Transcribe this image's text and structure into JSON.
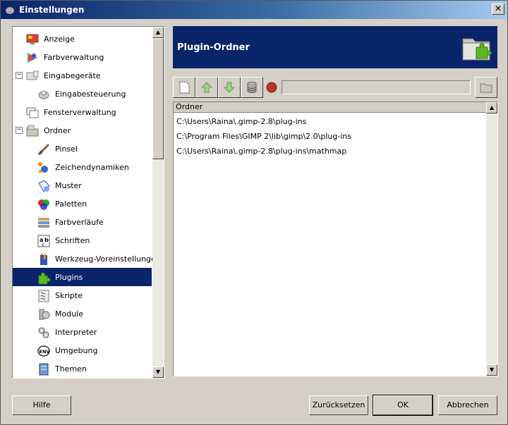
{
  "window": {
    "title": "Einstellungen"
  },
  "sidebar": {
    "items": [
      {
        "label": "Anzeige",
        "icon": "monitor-icon",
        "level": 0
      },
      {
        "label": "Farbverwaltung",
        "icon": "color-management-icon",
        "level": 0
      },
      {
        "label": "Eingabegeräte",
        "icon": "input-devices-icon",
        "level": 0,
        "expander": "−"
      },
      {
        "label": "Eingabesteuerung",
        "icon": "input-controllers-icon",
        "level": 1
      },
      {
        "label": "Fensterverwaltung",
        "icon": "window-management-icon",
        "level": 0
      },
      {
        "label": "Ordner",
        "icon": "folders-icon",
        "level": 0,
        "expander": "−"
      },
      {
        "label": "Pinsel",
        "icon": "brush-icon",
        "level": 1
      },
      {
        "label": "Zeichendynamiken",
        "icon": "paint-dynamics-icon",
        "level": 1
      },
      {
        "label": "Muster",
        "icon": "pattern-icon",
        "level": 1
      },
      {
        "label": "Paletten",
        "icon": "palette-icon",
        "level": 1
      },
      {
        "label": "Farbverläufe",
        "icon": "gradient-icon",
        "level": 1
      },
      {
        "label": "Schriften",
        "icon": "font-icon",
        "level": 1
      },
      {
        "label": "Werkzeug-Voreinstellungen",
        "icon": "tool-presets-icon",
        "level": 1
      },
      {
        "label": "Plugins",
        "icon": "plugin-icon",
        "level": 1,
        "selected": true
      },
      {
        "label": "Skripte",
        "icon": "script-icon",
        "level": 1
      },
      {
        "label": "Module",
        "icon": "module-icon",
        "level": 1
      },
      {
        "label": "Interpreter",
        "icon": "interpreter-icon",
        "level": 1
      },
      {
        "label": "Umgebung",
        "icon": "environment-icon",
        "level": 1
      },
      {
        "label": "Themen",
        "icon": "theme-icon",
        "level": 1
      }
    ]
  },
  "header": {
    "title": "Plugin-Ordner",
    "icon": "plugin-folder-icon"
  },
  "folder_list": {
    "column": "Ordner",
    "rows": [
      "C:\\Users\\Raina\\.gimp-2.8\\plug-ins",
      "C:\\Program Files\\GIMP 2\\lib\\gimp\\2.0\\plug-ins",
      "C:\\Users\\Raina\\.gimp-2.8\\plug-ins\\mathmap"
    ]
  },
  "path_input": {
    "value": ""
  },
  "buttons": {
    "help": "Hilfe",
    "reset": "Zurücksetzen",
    "ok": "OK",
    "cancel": "Abbrechen"
  },
  "colors": {
    "selection": "#0a246a",
    "accent_green": "#5ab82a"
  }
}
